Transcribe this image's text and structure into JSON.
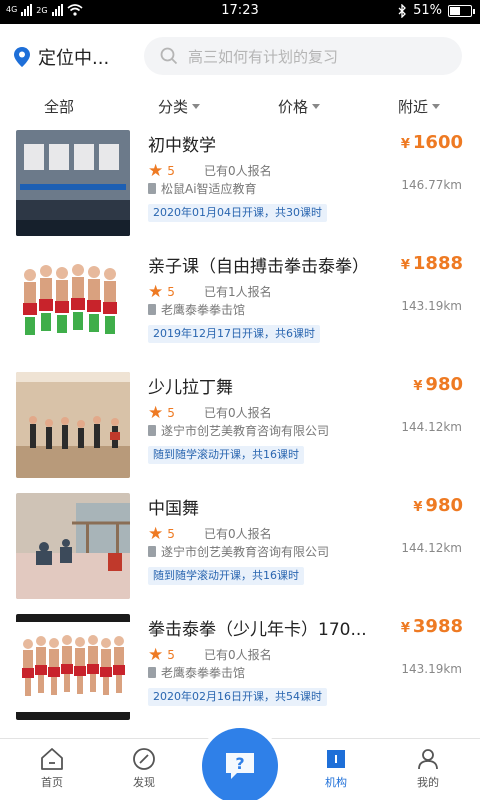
{
  "status_bar": {
    "network": "4G",
    "network2": "2G",
    "time": "17:23",
    "battery": "51%",
    "battery_level": 0.51
  },
  "header": {
    "location": "定位中...",
    "search_placeholder": "高三如何有计划的复习"
  },
  "filters": [
    "全部",
    "分类",
    "价格",
    "附近"
  ],
  "items": [
    {
      "title": "初中数学",
      "price": "1600",
      "rating": "5",
      "enrolled": "已有0人报名",
      "org": "松鼠Ai智适应教育",
      "distance": "146.77km",
      "tag": "2020年01月04日开课，共30课时"
    },
    {
      "title": "亲子课（自由搏击拳击泰拳）",
      "price": "1888",
      "rating": "5",
      "enrolled": "已有1人报名",
      "org": "老鹰泰拳拳击馆",
      "distance": "143.19km",
      "tag": "2019年12月17日开课，共6课时"
    },
    {
      "title": "少儿拉丁舞",
      "price": "980",
      "rating": "5",
      "enrolled": "已有0人报名",
      "org": "遂宁市创艺美教育咨询有限公司",
      "distance": "144.12km",
      "tag": "随到随学滚动开课，共16课时"
    },
    {
      "title": "中国舞",
      "price": "980",
      "rating": "5",
      "enrolled": "已有0人报名",
      "org": "遂宁市创艺美教育咨询有限公司",
      "distance": "144.12km",
      "tag": "随到随学滚动开课，共16课时"
    },
    {
      "title": "拳击泰拳（少儿年卡）170...",
      "price": "3988",
      "rating": "5",
      "enrolled": "已有0人报名",
      "org": "老鹰泰拳拳击馆",
      "distance": "143.19km",
      "tag": "2020年02月16日开课，共54课时"
    }
  ],
  "currency_symbol": "¥",
  "nav": [
    "首页",
    "发现",
    "机构",
    "我的"
  ],
  "colors": {
    "accent": "#1e6fd8",
    "price": "#ee7a23",
    "tag_bg": "#e9f1fb"
  }
}
